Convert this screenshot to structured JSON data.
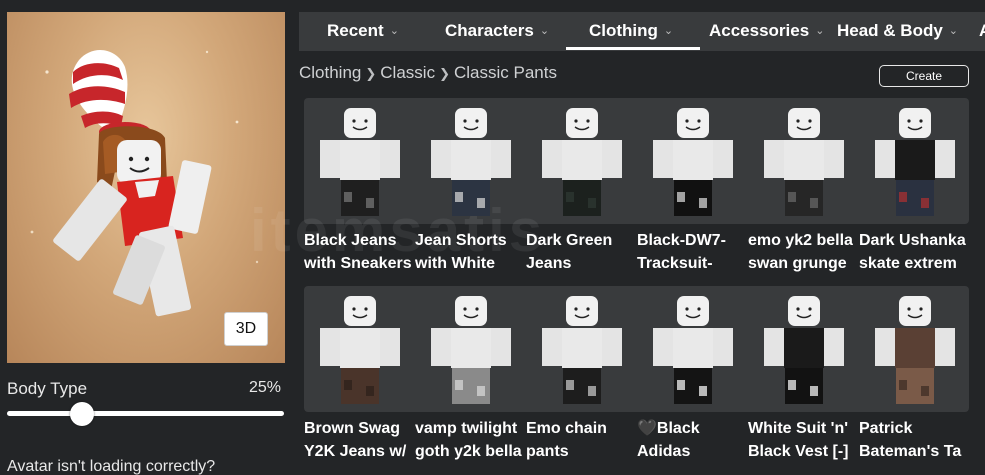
{
  "avatar": {
    "view_toggle_label": "3D"
  },
  "body_type": {
    "label": "Body Type",
    "value_text": "25%",
    "value_fraction": 0.25
  },
  "help": {
    "text": "Avatar isn't loading correctly?"
  },
  "tabs": [
    {
      "label": "Recent",
      "has_chevron": true,
      "active": false
    },
    {
      "label": "Characters",
      "has_chevron": true,
      "active": false
    },
    {
      "label": "Clothing",
      "has_chevron": true,
      "active": true
    },
    {
      "label": "Accessories",
      "has_chevron": true,
      "active": false
    },
    {
      "label": "Head & Body",
      "has_chevron": true,
      "active": false
    },
    {
      "label": "A",
      "has_chevron": false,
      "active": false
    }
  ],
  "breadcrumb": {
    "items": [
      "Clothing",
      "Classic",
      "Classic Pants"
    ]
  },
  "create_button": {
    "label": "Create"
  },
  "items": [
    {
      "line1": "Black Jeans",
      "line2": "with Sneakers",
      "pants": "#1f1f1f",
      "accent": "#7a7a7a",
      "torso": "#e9e9e9"
    },
    {
      "line1": "Jean Shorts",
      "line2": "with White",
      "pants": "#2c3442",
      "accent": "#dcdcdc",
      "torso": "#e9e9e9"
    },
    {
      "line1": "Dark Green",
      "line2": "Jeans",
      "pants": "#1c211e",
      "accent": "#2f3a33",
      "torso": "#e9e9e9"
    },
    {
      "line1": "Black-DW7-",
      "line2": "Tracksuit-",
      "pants": "#111111",
      "accent": "#e0e0e0",
      "torso": "#e9e9e9"
    },
    {
      "line1": "emo yk2 bella",
      "line2": "swan grunge",
      "pants": "#262626",
      "accent": "#6b6b6b",
      "torso": "#e9e9e9"
    },
    {
      "line1": "Dark Ushanka",
      "line2": "skate extrem",
      "pants": "#2a3140",
      "accent": "#b03030",
      "torso": "#1a1a1a"
    },
    {
      "line1": "Brown Swag",
      "line2": "Y2K Jeans w/",
      "pants": "#4a342a",
      "accent": "#2b1f19",
      "torso": "#e9e9e9"
    },
    {
      "line1": "vamp twilight",
      "line2": "goth y2k bella",
      "pants": "#8a8a8a",
      "accent": "#dcdcdc",
      "torso": "#e9e9e9"
    },
    {
      "line1": "Emo chain",
      "line2": "pants",
      "pants": "#1d1d1d",
      "accent": "#cfcfcf",
      "torso": "#e9e9e9"
    },
    {
      "line1": "🖤Black",
      "line2": "Adidas",
      "pants": "#141414",
      "accent": "#ffffff",
      "torso": "#e9e9e9"
    },
    {
      "line1": "White Suit 'n'",
      "line2": "Black Vest [-]",
      "pants": "#121212",
      "accent": "#ffffff",
      "torso": "#1a1a1a"
    },
    {
      "line1": "Patrick",
      "line2": "Bateman's Ta",
      "pants": "#7a5a48",
      "accent": "#3a2a22",
      "torso": "#5a4034"
    }
  ],
  "watermark": {
    "text": "itemsatis"
  },
  "colors": {
    "background": "#232527",
    "panel": "#393b3d",
    "text": "#ffffff"
  }
}
